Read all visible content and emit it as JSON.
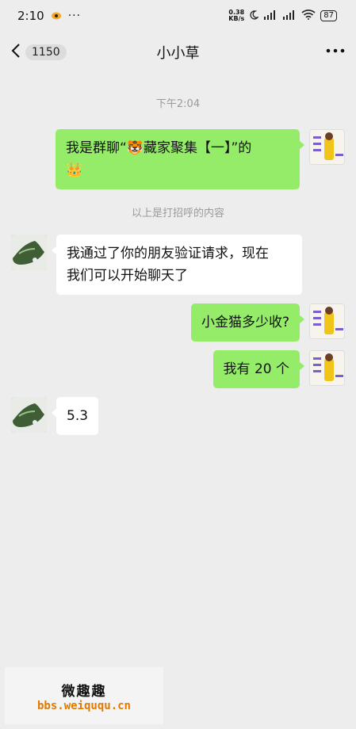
{
  "status_bar": {
    "time": "2:10",
    "dots": "···",
    "netspeed_value": "0.38",
    "netspeed_unit": "KB/s",
    "battery": "87"
  },
  "nav": {
    "back_badge": "1150",
    "title": "小小草"
  },
  "chat": {
    "timestamp": "下午2:04",
    "system_note": "以上是打招呼的内容",
    "messages": [
      {
        "side": "right",
        "text_line1": "我是群聊“🐯藏家聚集【一】”的",
        "text_line2": "👑"
      },
      {
        "side": "left",
        "text_line1": "我通过了你的朋友验证请求，现在",
        "text_line2": "我们可以开始聊天了"
      },
      {
        "side": "right",
        "text": "小金猫多少收?"
      },
      {
        "side": "right",
        "text": "我有 20 个"
      },
      {
        "side": "left",
        "text": "5.3"
      }
    ]
  },
  "watermark": {
    "title": "微趣趣",
    "url": "bbs.weiququ.cn"
  }
}
